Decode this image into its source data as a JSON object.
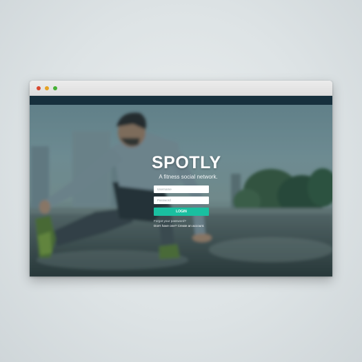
{
  "window": {
    "controls": [
      "close-dot",
      "minimize-dot",
      "maximize-dot"
    ]
  },
  "hero": {
    "background": "blurred photo of a man stretching on a wet street",
    "brand": "SPOTLY",
    "tagline": "A fitness social network."
  },
  "login_form": {
    "username_placeholder": "Username",
    "password_placeholder": "Password",
    "login_label": "LOGIN",
    "forgot_link": "Forgot your password?",
    "signup_link": "Don't have one? Create an account."
  },
  "colors": {
    "accent": "#1abfa0",
    "nav": "#17303d",
    "titlebar": "#e4e4e4"
  }
}
